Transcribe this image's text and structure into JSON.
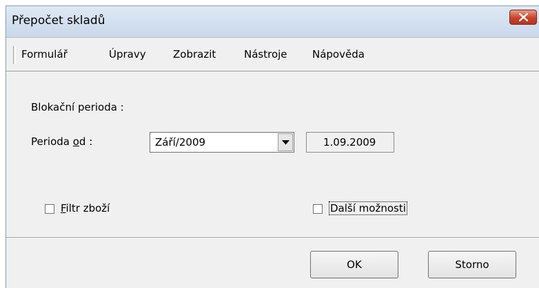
{
  "window": {
    "title": "Přepočet skladů",
    "close_icon": "close-icon"
  },
  "menu": {
    "items": [
      {
        "label": "Formulář"
      },
      {
        "label": "Úpravy"
      },
      {
        "label": "Zobrazit"
      },
      {
        "label": "Nástroje"
      },
      {
        "label": "Nápověda"
      }
    ]
  },
  "form": {
    "section_label": "Blokační perioda :",
    "period_label_prefix": "Perioda ",
    "period_label_accel": "o",
    "period_label_rest": "d :",
    "period_value": "Září/2009",
    "period_date": "1.09.2009",
    "filter_accel": "F",
    "filter_rest": "iltr zboží",
    "filter_checked": false,
    "more_label": "Další možnosti",
    "more_checked": false
  },
  "buttons": {
    "ok_label": "OK",
    "cancel_label": "Storno"
  }
}
